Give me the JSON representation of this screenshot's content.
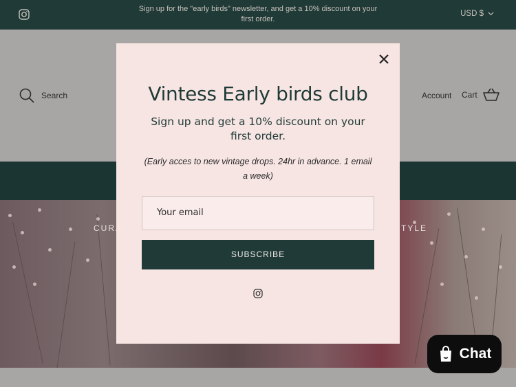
{
  "topbar": {
    "instagram_icon": "instagram-icon",
    "announcement": "Sign up for the \"early birds\" newsletter, and get a 10% discount on your first order.",
    "currency": "USD $",
    "currency_chevron": "chevron-down-icon"
  },
  "header": {
    "search_label": "Search",
    "account_label": "Account",
    "cart_label": "Cart"
  },
  "hero": {
    "heading_left": "CURA",
    "heading_right": "TYLE"
  },
  "modal": {
    "title": "Vintess Early birds club",
    "subtitle": "Sign up and get a 10% discount on your first order.",
    "note": "(Early acces to new vintage drops. 24hr in advance. 1 email a week)",
    "email_placeholder": "Your email",
    "subscribe_label": "SUBSCRIBE",
    "close_icon": "close-icon",
    "social_icon": "instagram-icon"
  },
  "chat": {
    "label": "Chat",
    "icon": "shopify-bag-icon"
  },
  "colors": {
    "dark_green": "#1f3a37",
    "modal_bg": "#f7e5e3",
    "header_bg": "#a8a6a4",
    "chat_bg": "#0d0d0d"
  }
}
